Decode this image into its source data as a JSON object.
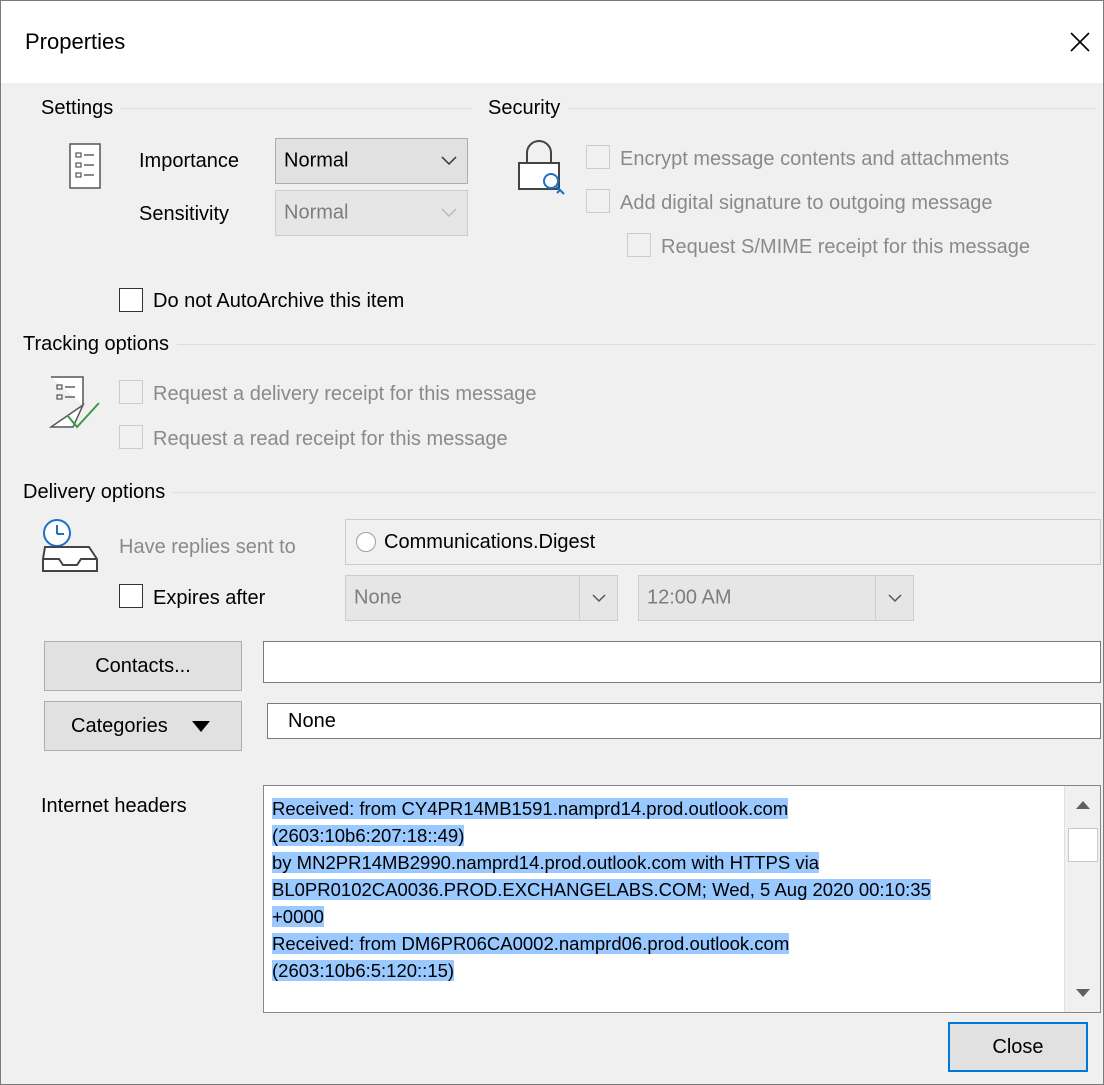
{
  "dialog": {
    "title": "Properties"
  },
  "settings": {
    "group_label": "Settings",
    "importance_label": "Importance",
    "importance_value": "Normal",
    "sensitivity_label": "Sensitivity",
    "sensitivity_value": "Normal",
    "autoarchive_label": "Do not AutoArchive this item"
  },
  "security": {
    "group_label": "Security",
    "encrypt_label": "Encrypt message contents and attachments",
    "signature_label": "Add digital signature to outgoing message",
    "smime_label": "Request S/MIME receipt for this message"
  },
  "tracking": {
    "group_label": "Tracking options",
    "delivery_receipt_label": "Request a delivery receipt for this message",
    "read_receipt_label": "Request a read receipt for this message"
  },
  "delivery": {
    "group_label": "Delivery options",
    "replies_label": "Have replies sent to",
    "replies_value": "Communications.Digest",
    "expires_label": "Expires after",
    "expires_date": "None",
    "expires_time": "12:00 AM"
  },
  "contacts": {
    "button_label": "Contacts...",
    "value": ""
  },
  "categories": {
    "button_label": "Categories",
    "value": "None"
  },
  "internet_headers": {
    "label": "Internet headers",
    "lines": [
      "Received: from CY4PR14MB1591.namprd14.prod.outlook.com",
      "(2603:10b6:207:18::49)",
      " by MN2PR14MB2990.namprd14.prod.outlook.com with HTTPS via",
      " BL0PR0102CA0036.PROD.EXCHANGELABS.COM; Wed, 5 Aug 2020 00:10:35",
      "+0000",
      "Received: from DM6PR06CA0002.namprd06.prod.outlook.com",
      "(2603:10b6:5:120::15)"
    ]
  },
  "footer": {
    "close_label": "Close"
  },
  "colors": {
    "selection": "#99c9ff",
    "default_button_border": "#0078d7",
    "check_green": "#3c9a45",
    "dialog_bg": "#f0f0f0"
  }
}
